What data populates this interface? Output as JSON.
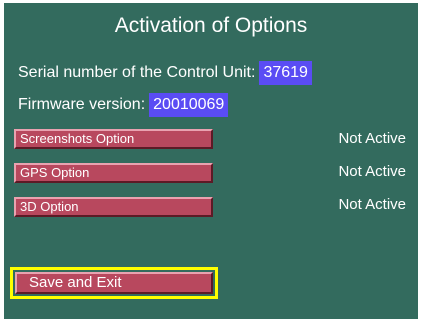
{
  "title": "Activation of Options",
  "serial": {
    "label": "Serial number of the Control Unit:",
    "value": "37619"
  },
  "firmware": {
    "label": "Firmware version:",
    "value": "20010069"
  },
  "options": [
    {
      "label": "Screenshots Option",
      "status": "Not Active"
    },
    {
      "label": "GPS Option",
      "status": "Not Active"
    },
    {
      "label": "3D Option",
      "status": "Not Active"
    }
  ],
  "save_label": "Save and Exit",
  "colors": {
    "background": "#336b5e",
    "button": "#b8485e",
    "value_box": "#5a4cf4",
    "focus_highlight": "#ffff00"
  }
}
